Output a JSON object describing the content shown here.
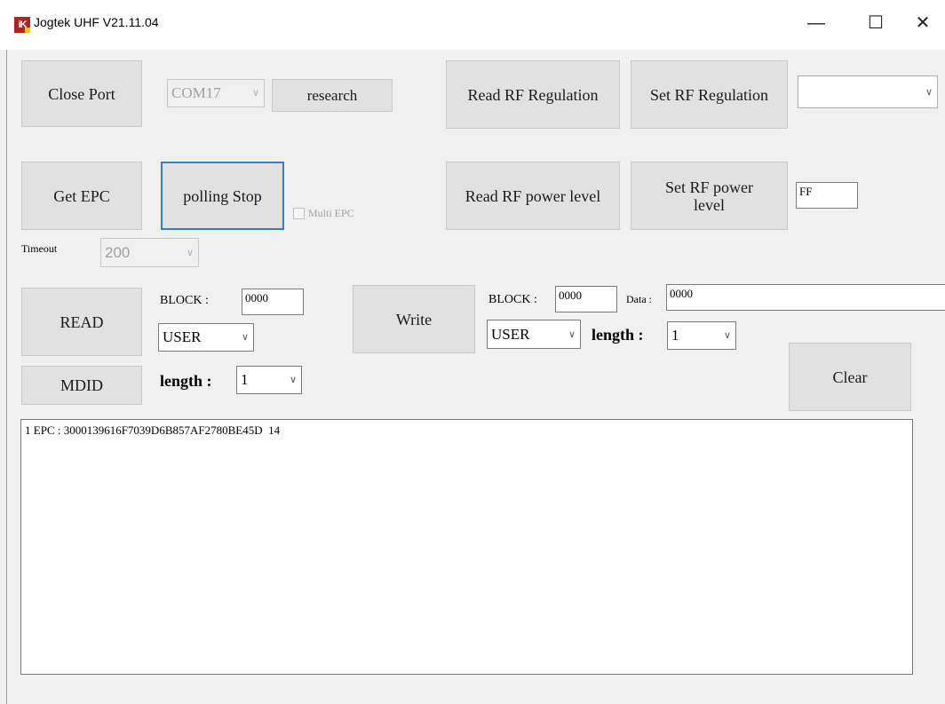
{
  "window": {
    "title": "Jogtek UHF V21.11.04",
    "icon_label": "iK",
    "minimize_icon": "minimize-icon",
    "maximize_icon": "maximize-icon",
    "close_icon": "close-icon"
  },
  "port": {
    "close_port_label": "Close Port",
    "com_value": "COM17",
    "research_label": "research"
  },
  "rf_regulation": {
    "read_label": "Read RF Regulation",
    "set_label": "Set RF Regulation",
    "region_value": ""
  },
  "epc": {
    "get_label": "Get EPC",
    "polling_label": "polling Stop",
    "multi_epc_label": "Multi EPC",
    "multi_epc_checked": false,
    "timeout_label": "Timeout",
    "timeout_value": "200"
  },
  "rf_power": {
    "read_label": "Read RF power level",
    "set_label": "Set RF power level",
    "value": "FF"
  },
  "read": {
    "button_label": "READ",
    "block_label": "BLOCK :",
    "block_value": "0000",
    "bank_value": "USER",
    "mdid_label": "MDID",
    "length_label": "length :",
    "length_value": "1"
  },
  "write": {
    "button_label": "Write",
    "block_label": "BLOCK :",
    "block_value": "0000",
    "data_label": "Data :",
    "data_value": "0000",
    "bank_value": "USER",
    "length_label": "length :",
    "length_value": "1"
  },
  "clear_label": "Clear",
  "output_text": "1 EPC : 3000139616F7039D6B857AF2780BE45D  14",
  "colors": {
    "button_face": "#e1e1e1",
    "focus_border": "#2f7fd0",
    "window_bg": "#f0f0f0"
  }
}
